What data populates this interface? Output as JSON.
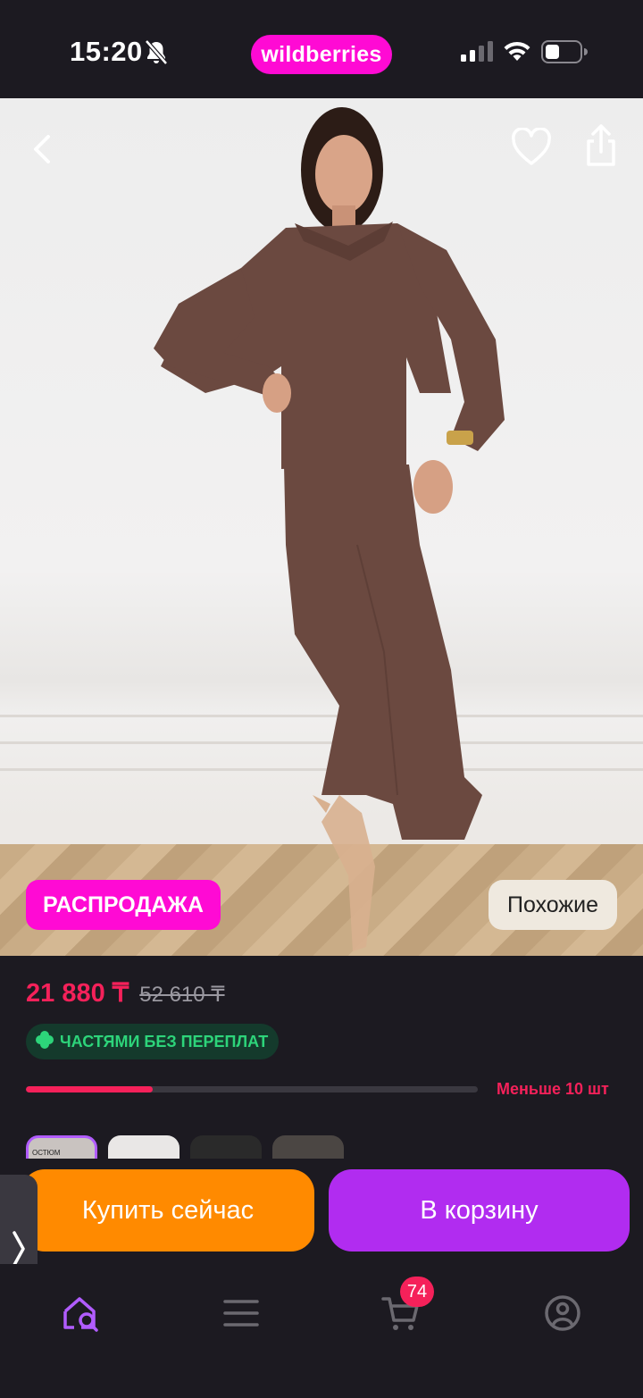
{
  "status_bar": {
    "time": "15:20",
    "brand": "wildberries",
    "icons": [
      "bell-muted-icon",
      "signal-icon",
      "wifi-icon",
      "battery-icon"
    ]
  },
  "product": {
    "badge": "РАСПРОДАЖА",
    "similar_label": "Похожие",
    "price": "21 880 ₸",
    "old_price": "52 610 ₸",
    "installment_label": "ЧАСТЯМИ БЕЗ ПЕРЕПЛАТ",
    "stock_label": "Меньше 10 шт",
    "stock_level_fraction": 0.28,
    "thumbnail_caption": "ОСТЮМ"
  },
  "actions": {
    "buy_now": "Купить сейчас",
    "add_to_cart": "В корзину"
  },
  "tab_bar": {
    "cart_count": "74",
    "tabs": [
      "home-search-icon",
      "menu-icon",
      "cart-icon",
      "profile-icon"
    ]
  },
  "colors": {
    "brand": "#ff0ad4",
    "price": "#f5215a",
    "buy_now": "#ff8a00",
    "add_to_cart": "#b12cf0",
    "installment_text": "#2dd47a",
    "background": "#1c1a21"
  }
}
